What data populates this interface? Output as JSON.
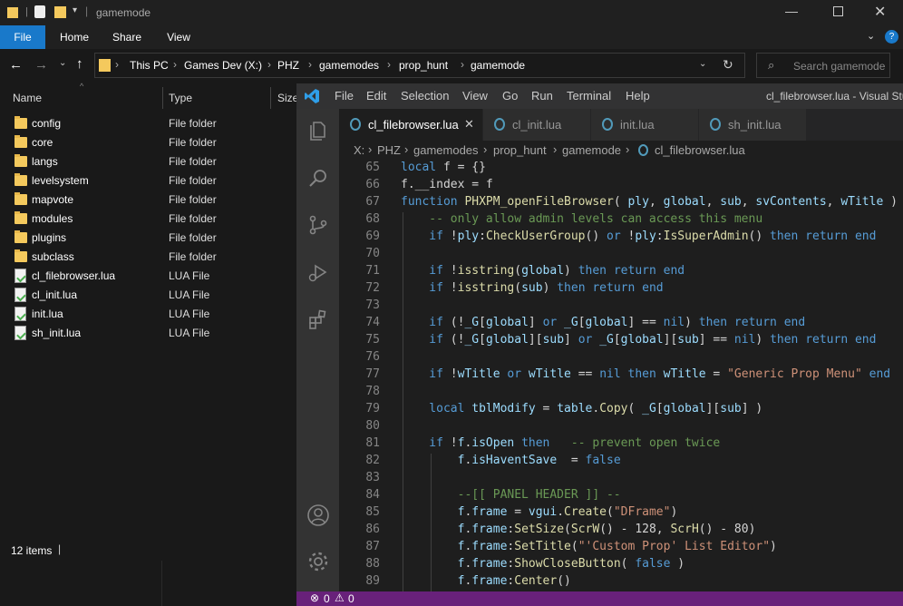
{
  "explorer": {
    "title": "gamemode",
    "ribbon_tabs": [
      "File",
      "Home",
      "Share",
      "View"
    ],
    "breadcrumb": [
      "This PC",
      "Games Dev (X:)",
      "PHZ",
      "gamemodes",
      "prop_hunt",
      "gamemode"
    ],
    "search_placeholder": "Search gamemode",
    "columns": {
      "name": "Name",
      "type": "Type",
      "size": "Size"
    },
    "items": [
      {
        "name": "config",
        "type": "File folder",
        "kind": "folder"
      },
      {
        "name": "core",
        "type": "File folder",
        "kind": "folder"
      },
      {
        "name": "langs",
        "type": "File folder",
        "kind": "folder"
      },
      {
        "name": "levelsystem",
        "type": "File folder",
        "kind": "folder"
      },
      {
        "name": "mapvote",
        "type": "File folder",
        "kind": "folder"
      },
      {
        "name": "modules",
        "type": "File folder",
        "kind": "folder"
      },
      {
        "name": "plugins",
        "type": "File folder",
        "kind": "folder"
      },
      {
        "name": "subclass",
        "type": "File folder",
        "kind": "folder"
      },
      {
        "name": "cl_filebrowser.lua",
        "type": "LUA File",
        "kind": "lua"
      },
      {
        "name": "cl_init.lua",
        "type": "LUA File",
        "kind": "lua"
      },
      {
        "name": "init.lua",
        "type": "LUA File",
        "kind": "lua"
      },
      {
        "name": "sh_init.lua",
        "type": "LUA File",
        "kind": "lua"
      }
    ],
    "status": "12 items"
  },
  "vscode": {
    "menu": [
      "File",
      "Edit",
      "Selection",
      "View",
      "Go",
      "Run",
      "Terminal",
      "Help"
    ],
    "window_title": "cl_filebrowser.lua - Visual Stu",
    "tabs": [
      "cl_filebrowser.lua",
      "cl_init.lua",
      "init.lua",
      "sh_init.lua"
    ],
    "breadcrumb": [
      "X:",
      "PHZ",
      "gamemodes",
      "prop_hunt",
      "gamemode",
      "cl_filebrowser.lua"
    ],
    "status_errors": "0",
    "status_warnings": "0",
    "code_lines": [
      {
        "n": "65",
        "segs": [
          [
            "kw",
            "local "
          ],
          [
            "tx",
            "f = {}"
          ]
        ]
      },
      {
        "n": "66",
        "segs": [
          [
            "tx",
            "f.__index = f"
          ]
        ]
      },
      {
        "n": "67",
        "segs": [
          [
            "kw",
            "function "
          ],
          [
            "fn",
            "PHXPM_openFileBrowser"
          ],
          [
            "tx",
            "( "
          ],
          [
            "var",
            "ply"
          ],
          [
            "tx",
            ", "
          ],
          [
            "var",
            "global"
          ],
          [
            "tx",
            ", "
          ],
          [
            "var",
            "sub"
          ],
          [
            "tx",
            ", "
          ],
          [
            "var",
            "svContents"
          ],
          [
            "tx",
            ", "
          ],
          [
            "var",
            "wTitle"
          ],
          [
            "tx",
            " )"
          ]
        ]
      },
      {
        "n": "68",
        "segs": [
          [
            "cm",
            "    -- only allow admin levels can access this menu"
          ]
        ]
      },
      {
        "n": "69",
        "segs": [
          [
            "kw",
            "    if "
          ],
          [
            "tx",
            "!"
          ],
          [
            "var",
            "ply"
          ],
          [
            "tx",
            ":"
          ],
          [
            "fn",
            "CheckUserGroup"
          ],
          [
            "tx",
            "() "
          ],
          [
            "kw",
            "or "
          ],
          [
            "tx",
            "!"
          ],
          [
            "var",
            "ply"
          ],
          [
            "tx",
            ":"
          ],
          [
            "fn",
            "IsSuperAdmin"
          ],
          [
            "tx",
            "() "
          ],
          [
            "kw",
            "then return end"
          ]
        ]
      },
      {
        "n": "70",
        "segs": [
          [
            "tx",
            ""
          ]
        ]
      },
      {
        "n": "71",
        "segs": [
          [
            "kw",
            "    if "
          ],
          [
            "tx",
            "!"
          ],
          [
            "fn",
            "isstring"
          ],
          [
            "tx",
            "("
          ],
          [
            "var",
            "global"
          ],
          [
            "tx",
            ") "
          ],
          [
            "kw",
            "then return end"
          ]
        ]
      },
      {
        "n": "72",
        "segs": [
          [
            "kw",
            "    if "
          ],
          [
            "tx",
            "!"
          ],
          [
            "fn",
            "isstring"
          ],
          [
            "tx",
            "("
          ],
          [
            "var",
            "sub"
          ],
          [
            "tx",
            ") "
          ],
          [
            "kw",
            "then return end"
          ]
        ]
      },
      {
        "n": "73",
        "segs": [
          [
            "tx",
            ""
          ]
        ]
      },
      {
        "n": "74",
        "segs": [
          [
            "kw",
            "    if "
          ],
          [
            "tx",
            "(!"
          ],
          [
            "var",
            "_G"
          ],
          [
            "tx",
            "["
          ],
          [
            "var",
            "global"
          ],
          [
            "tx",
            "] "
          ],
          [
            "kw",
            "or "
          ],
          [
            "var",
            "_G"
          ],
          [
            "tx",
            "["
          ],
          [
            "var",
            "global"
          ],
          [
            "tx",
            "] == "
          ],
          [
            "kw",
            "nil"
          ],
          [
            "tx",
            ") "
          ],
          [
            "kw",
            "then return end"
          ]
        ]
      },
      {
        "n": "75",
        "segs": [
          [
            "kw",
            "    if "
          ],
          [
            "tx",
            "(!"
          ],
          [
            "var",
            "_G"
          ],
          [
            "tx",
            "["
          ],
          [
            "var",
            "global"
          ],
          [
            "tx",
            "]["
          ],
          [
            "var",
            "sub"
          ],
          [
            "tx",
            "] "
          ],
          [
            "kw",
            "or "
          ],
          [
            "var",
            "_G"
          ],
          [
            "tx",
            "["
          ],
          [
            "var",
            "global"
          ],
          [
            "tx",
            "]["
          ],
          [
            "var",
            "sub"
          ],
          [
            "tx",
            "] == "
          ],
          [
            "kw",
            "nil"
          ],
          [
            "tx",
            ") "
          ],
          [
            "kw",
            "then return end"
          ]
        ]
      },
      {
        "n": "76",
        "segs": [
          [
            "tx",
            ""
          ]
        ]
      },
      {
        "n": "77",
        "segs": [
          [
            "kw",
            "    if "
          ],
          [
            "tx",
            "!"
          ],
          [
            "var",
            "wTitle "
          ],
          [
            "kw",
            "or "
          ],
          [
            "var",
            "wTitle"
          ],
          [
            "tx",
            " == "
          ],
          [
            "kw",
            "nil then "
          ],
          [
            "var",
            "wTitle"
          ],
          [
            "tx",
            " = "
          ],
          [
            "str",
            "\"Generic Prop Menu\""
          ],
          [
            "kw",
            " end"
          ]
        ]
      },
      {
        "n": "78",
        "segs": [
          [
            "tx",
            ""
          ]
        ]
      },
      {
        "n": "79",
        "segs": [
          [
            "kw",
            "    local "
          ],
          [
            "var",
            "tblModify"
          ],
          [
            "tx",
            " = "
          ],
          [
            "var",
            "table"
          ],
          [
            "tx",
            "."
          ],
          [
            "fn",
            "Copy"
          ],
          [
            "tx",
            "( "
          ],
          [
            "var",
            "_G"
          ],
          [
            "tx",
            "["
          ],
          [
            "var",
            "global"
          ],
          [
            "tx",
            "]["
          ],
          [
            "var",
            "sub"
          ],
          [
            "tx",
            "] )"
          ]
        ]
      },
      {
        "n": "80",
        "segs": [
          [
            "tx",
            ""
          ]
        ]
      },
      {
        "n": "81",
        "segs": [
          [
            "kw",
            "    if "
          ],
          [
            "tx",
            "!"
          ],
          [
            "var",
            "f"
          ],
          [
            "tx",
            "."
          ],
          [
            "var",
            "isOpen "
          ],
          [
            "kw",
            "then"
          ],
          [
            "cm",
            "   -- prevent open twice"
          ]
        ]
      },
      {
        "n": "82",
        "segs": [
          [
            "tx",
            "        "
          ],
          [
            "var",
            "f"
          ],
          [
            "tx",
            "."
          ],
          [
            "var",
            "isHaventSave"
          ],
          [
            "tx",
            "  = "
          ],
          [
            "kw",
            "false"
          ]
        ]
      },
      {
        "n": "83",
        "segs": [
          [
            "tx",
            ""
          ]
        ]
      },
      {
        "n": "84",
        "segs": [
          [
            "cm",
            "        --[[ PANEL HEADER ]] --"
          ]
        ]
      },
      {
        "n": "85",
        "segs": [
          [
            "tx",
            "        "
          ],
          [
            "var",
            "f"
          ],
          [
            "tx",
            "."
          ],
          [
            "var",
            "frame"
          ],
          [
            "tx",
            " = "
          ],
          [
            "var",
            "vgui"
          ],
          [
            "tx",
            "."
          ],
          [
            "fn",
            "Create"
          ],
          [
            "tx",
            "("
          ],
          [
            "str",
            "\"DFrame\""
          ],
          [
            "tx",
            ")"
          ]
        ]
      },
      {
        "n": "86",
        "segs": [
          [
            "tx",
            "        "
          ],
          [
            "var",
            "f"
          ],
          [
            "tx",
            "."
          ],
          [
            "var",
            "frame"
          ],
          [
            "tx",
            ":"
          ],
          [
            "fn",
            "SetSize"
          ],
          [
            "tx",
            "("
          ],
          [
            "fn",
            "ScrW"
          ],
          [
            "tx",
            "() - 128, "
          ],
          [
            "fn",
            "ScrH"
          ],
          [
            "tx",
            "() - 80)"
          ]
        ]
      },
      {
        "n": "87",
        "segs": [
          [
            "tx",
            "        "
          ],
          [
            "var",
            "f"
          ],
          [
            "tx",
            "."
          ],
          [
            "var",
            "frame"
          ],
          [
            "tx",
            ":"
          ],
          [
            "fn",
            "SetTitle"
          ],
          [
            "tx",
            "("
          ],
          [
            "str",
            "\"'Custom Prop' List Editor\""
          ],
          [
            "tx",
            ")"
          ]
        ]
      },
      {
        "n": "88",
        "segs": [
          [
            "tx",
            "        "
          ],
          [
            "var",
            "f"
          ],
          [
            "tx",
            "."
          ],
          [
            "var",
            "frame"
          ],
          [
            "tx",
            ":"
          ],
          [
            "fn",
            "ShowCloseButton"
          ],
          [
            "tx",
            "( "
          ],
          [
            "kw",
            "false"
          ],
          [
            "tx",
            " )"
          ]
        ]
      },
      {
        "n": "89",
        "segs": [
          [
            "tx",
            "        "
          ],
          [
            "var",
            "f"
          ],
          [
            "tx",
            "."
          ],
          [
            "var",
            "frame"
          ],
          [
            "tx",
            ":"
          ],
          [
            "fn",
            "Center"
          ],
          [
            "tx",
            "()"
          ]
        ]
      }
    ]
  }
}
